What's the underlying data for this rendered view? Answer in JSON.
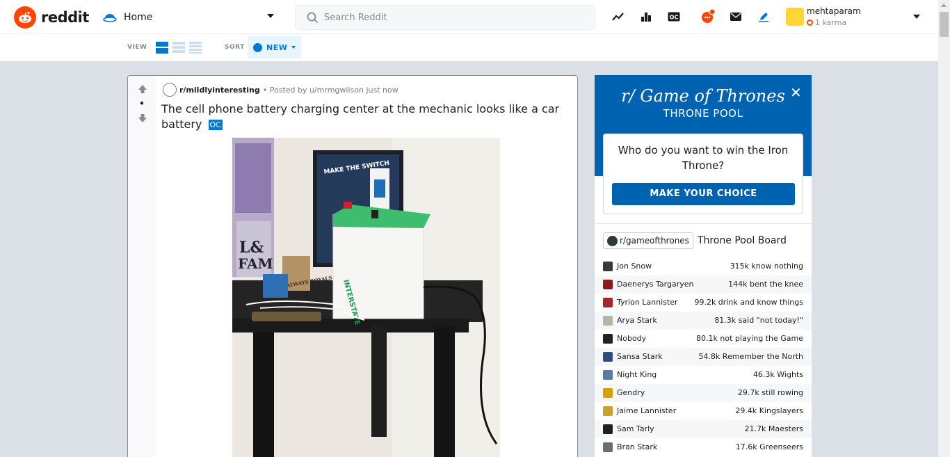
{
  "header": {
    "logo_text": "reddit",
    "home_label": "Home",
    "search_placeholder": "Search Reddit",
    "username": "mehtaparam",
    "karma": "1 karma",
    "icons": [
      "trending-icon",
      "stats-icon",
      "oc-icon",
      "chat-icon",
      "mail-icon",
      "create-post-icon"
    ]
  },
  "sortbar": {
    "view_label": "VIEW",
    "sort_label": "SORT",
    "sort_value": "NEW"
  },
  "post": {
    "subreddit": "r/mildlyinteresting",
    "meta": "• Posted by u/mrmgwilson just now",
    "score": "•",
    "title": "The cell phone battery charging center at the mechanic looks like a car battery",
    "flair": "OC",
    "photo_text": {
      "poster": "MAKE THE SWITCH",
      "battery_brand": "INTERSTATE",
      "magazine": "ALWAYS ROYALS"
    }
  },
  "got": {
    "title": "r/ Game of Thrones",
    "subtitle": "THRONE POOL",
    "question": "Who do you want to win the Iron Throne?",
    "button": "MAKE YOUR CHOICE",
    "subreddit": "r/gameofthrones",
    "board_label": "Throne Pool Board",
    "rows": [
      {
        "name": "Jon Snow",
        "stat": "315k know nothing",
        "color": "#3a3a3a"
      },
      {
        "name": "Daenerys Targaryen",
        "stat": "144k bent the knee",
        "color": "#8b1a1a"
      },
      {
        "name": "Tyrion Lannister",
        "stat": "99.2k drink and know things",
        "color": "#a8262b"
      },
      {
        "name": "Arya Stark",
        "stat": "81.3k said \"not today!\"",
        "color": "#b6b4a8"
      },
      {
        "name": "Nobody",
        "stat": "80.1k not playing the Game",
        "color": "#222222"
      },
      {
        "name": "Sansa Stark",
        "stat": "54.8k Remember the North",
        "color": "#2c4f7c"
      },
      {
        "name": "Night King",
        "stat": "46.3k Wights",
        "color": "#5b7aa8"
      },
      {
        "name": "Gendry",
        "stat": "29.7k still rowing",
        "color": "#d3a400"
      },
      {
        "name": "Jaime Lannister",
        "stat": "29.4k Kingslayers",
        "color": "#c9a227"
      },
      {
        "name": "Sam Tarly",
        "stat": "21.7k Maesters",
        "color": "#1e1e1e"
      },
      {
        "name": "Bran Stark",
        "stat": "17.6k Greenseers",
        "color": "#6d6d6d"
      }
    ]
  }
}
